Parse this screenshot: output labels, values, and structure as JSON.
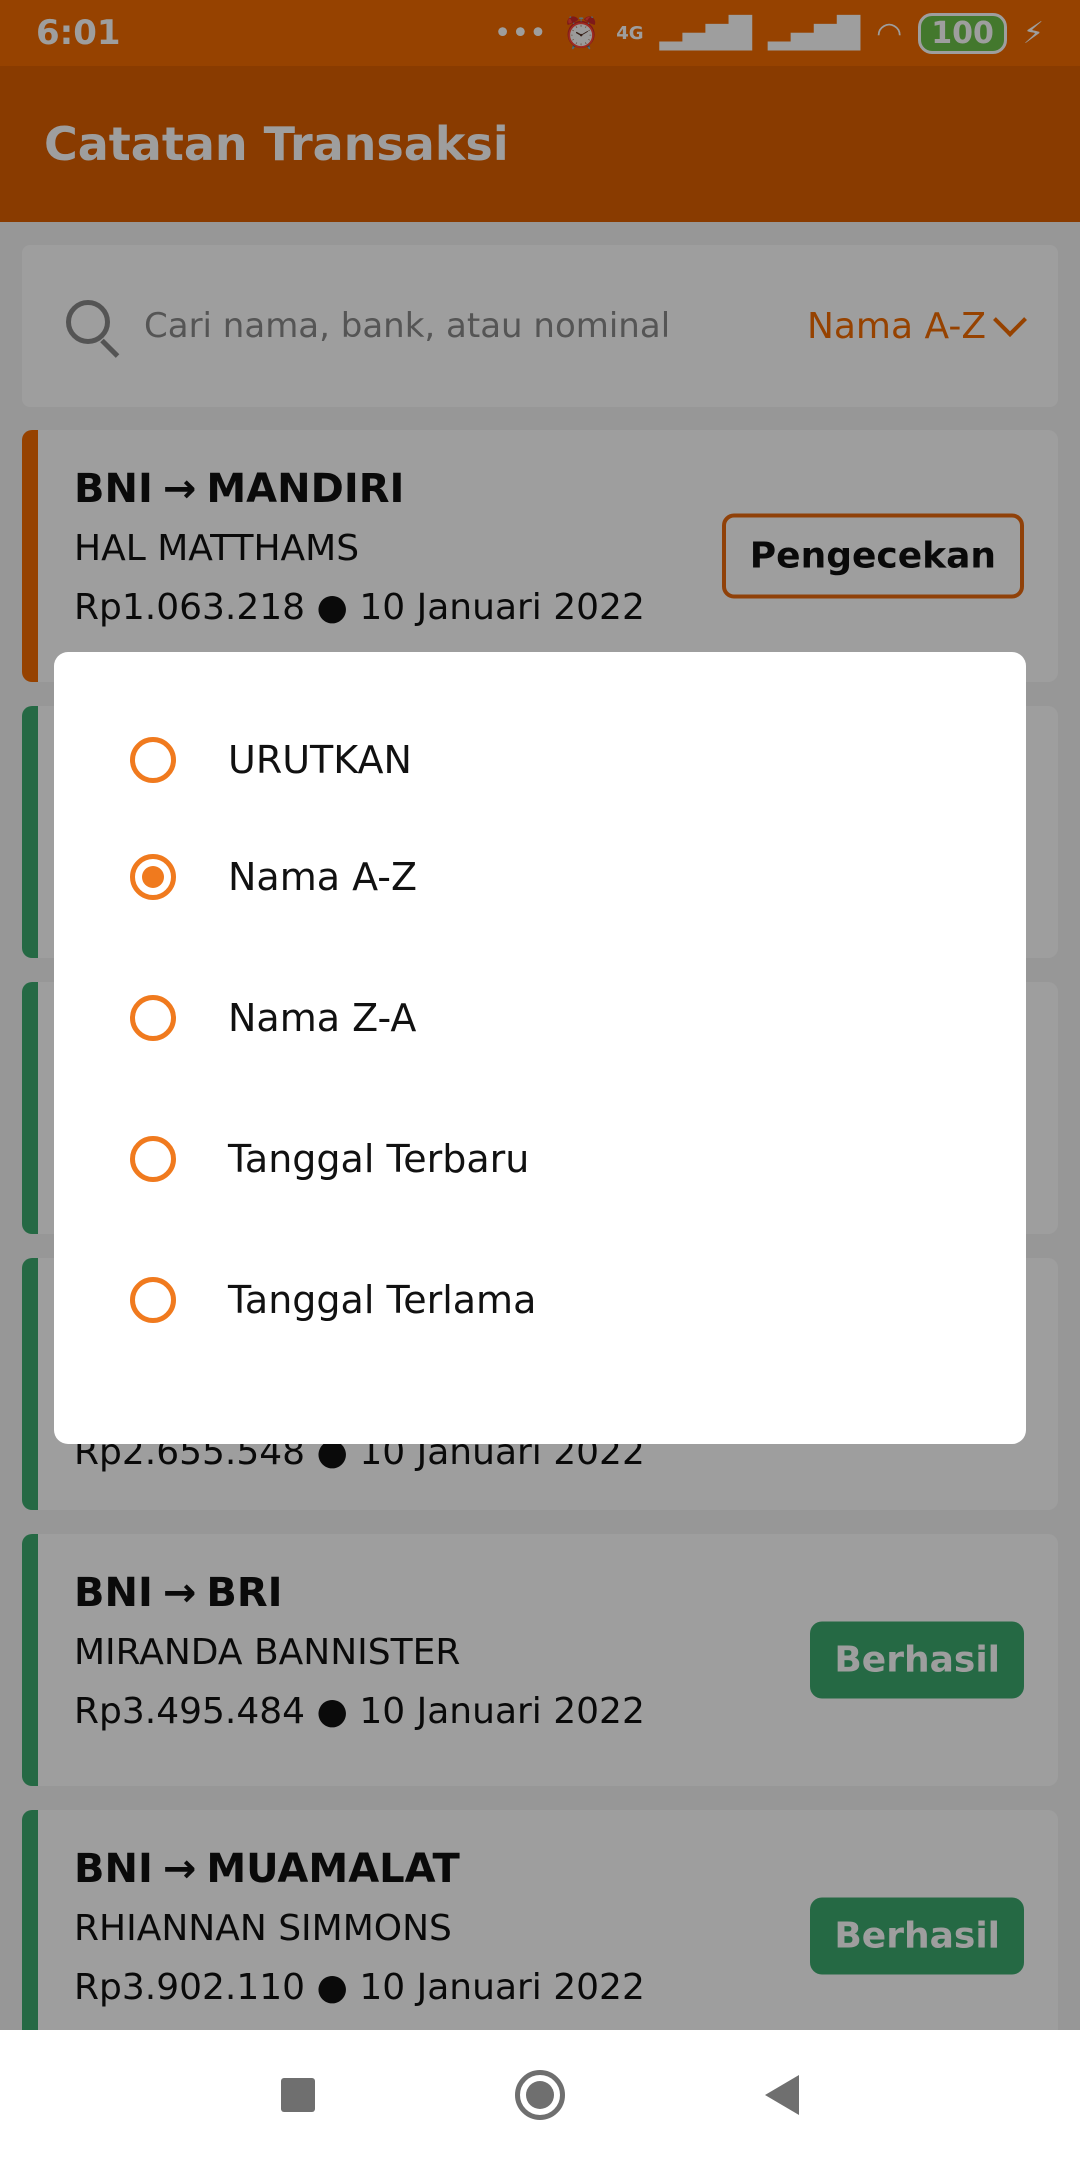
{
  "status_bar": {
    "time": "6:01",
    "battery": "100",
    "network": "4G"
  },
  "app_bar": {
    "title": "Catatan Transaksi"
  },
  "search": {
    "placeholder": "Cari nama, bank, atau nominal",
    "sort_label": "Nama A-Z"
  },
  "transactions": [
    {
      "route_from": "BNI",
      "route_to": "MANDIRI",
      "name": "HAL MATTHAMS",
      "amount_date": "Rp1.063.218 ● 10 Januari 2022",
      "status": "Pengecekan",
      "accent": "#F26B00"
    },
    {
      "route_from": "",
      "route_to": "",
      "name": "",
      "amount_date": "Rp2.655.548 ● 10 Januari 2022",
      "status": "",
      "accent": "#3DAA6E"
    },
    {
      "route_from": "BNI",
      "route_to": "BRI",
      "name": "MIRANDA BANNISTER",
      "amount_date": "Rp3.495.484 ● 10 Januari 2022",
      "status": "Berhasil",
      "accent": "#3DAA6E"
    },
    {
      "route_from": "BNI",
      "route_to": "MUAMALAT",
      "name": "RHIANNAN SIMMONS",
      "amount_date": "Rp3.902.110 ● 10 Januari 2022",
      "status": "Berhasil",
      "accent": "#3DAA6E"
    }
  ],
  "sort_dialog": {
    "options": [
      {
        "label": "URUTKAN",
        "selected": false
      },
      {
        "label": "Nama A-Z",
        "selected": true
      },
      {
        "label": "Nama Z-A",
        "selected": false
      },
      {
        "label": "Tanggal Terbaru",
        "selected": false
      },
      {
        "label": "Tanggal Terlama",
        "selected": false
      }
    ]
  },
  "colors": {
    "primary": "#F26B00",
    "success": "#3DAA6E",
    "radio": "#F07A1E"
  }
}
